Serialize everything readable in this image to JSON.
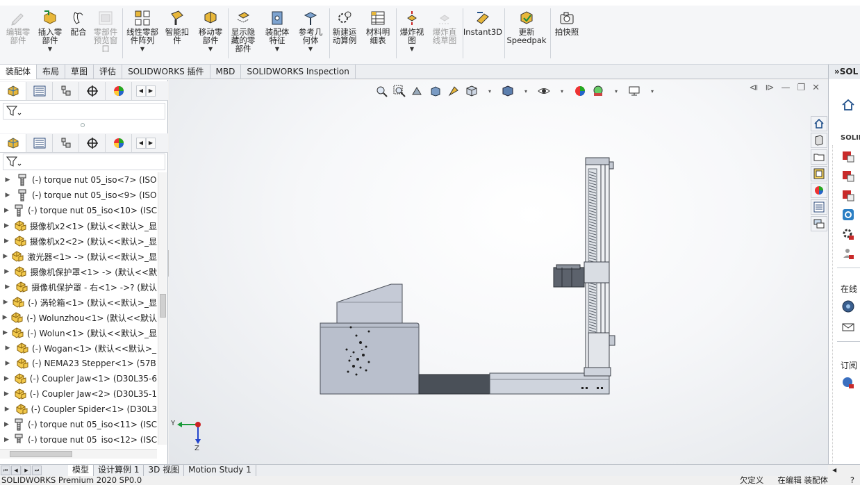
{
  "colors": {
    "accent": "#2b6fb6",
    "part_yellow": "#e8b73a",
    "viewport_bg": "#f4f5f7"
  },
  "ribbon": {
    "buttons": [
      {
        "key": "edit_component",
        "label": "编辑零\n部件",
        "icon": "edit-component-icon",
        "disabled": true,
        "caret": false
      },
      {
        "key": "insert_components",
        "label": "插入零\n部件",
        "icon": "insert-components-icon",
        "disabled": false,
        "caret": true
      },
      {
        "key": "mate",
        "label": "配合",
        "icon": "mate-icon",
        "disabled": false,
        "caret": false
      },
      {
        "key": "component_preview",
        "label": "零部件\n预览窗\n口",
        "icon": "component-preview-icon",
        "disabled": true,
        "caret": false
      },
      {
        "key": "linear_pattern",
        "label": "线性零部\n件阵列",
        "icon": "linear-pattern-icon",
        "disabled": false,
        "caret": true
      },
      {
        "key": "smart_fasteners",
        "label": "智能扣\n件",
        "icon": "smart-fasteners-icon",
        "disabled": false,
        "caret": false
      },
      {
        "key": "move_component",
        "label": "移动零\n部件",
        "icon": "move-component-icon",
        "disabled": false,
        "caret": true
      },
      {
        "key": "show_hidden",
        "label": "显示隐\n藏的零\n部件",
        "icon": "show-hidden-icon",
        "disabled": false,
        "caret": false
      },
      {
        "key": "assembly_features",
        "label": "装配体\n特征",
        "icon": "assembly-features-icon",
        "disabled": false,
        "caret": true
      },
      {
        "key": "reference_geometry",
        "label": "参考几\n何体",
        "icon": "reference-geometry-icon",
        "disabled": false,
        "caret": true
      },
      {
        "key": "new_motion_study",
        "label": "新建运\n动算例",
        "icon": "motion-study-icon",
        "disabled": false,
        "caret": false
      },
      {
        "key": "bom",
        "label": "材料明\n细表",
        "icon": "bom-icon",
        "disabled": false,
        "caret": false
      },
      {
        "key": "exploded_view",
        "label": "爆炸视\n图",
        "icon": "exploded-view-icon",
        "disabled": false,
        "caret": true
      },
      {
        "key": "explode_line",
        "label": "爆炸直\n线草图",
        "icon": "explode-line-icon",
        "disabled": true,
        "caret": false
      },
      {
        "key": "instant3d",
        "label": "Instant3D",
        "icon": "instant3d-icon",
        "disabled": false,
        "caret": false
      },
      {
        "key": "speedpak",
        "label": "更新\nSpeedpak",
        "icon": "speedpak-icon",
        "disabled": false,
        "caret": false
      },
      {
        "key": "snapshot",
        "label": "拍快照",
        "icon": "camera-icon",
        "disabled": false,
        "caret": false
      }
    ]
  },
  "tabs": [
    "装配体",
    "布局",
    "草图",
    "评估",
    "SOLIDWORKS 插件",
    "MBD",
    "SOLIDWORKS Inspection"
  ],
  "active_tab": "装配体",
  "tree": {
    "nodes": [
      {
        "icon": "bolt-icon",
        "label": "(-) torque nut 05_iso<7> (ISO"
      },
      {
        "icon": "bolt-icon",
        "label": "(-) torque nut 05_iso<9> (ISO"
      },
      {
        "icon": "bolt-icon",
        "label": "(-) torque nut 05_iso<10> (ISC"
      },
      {
        "icon": "part-icon",
        "label": "摄像机x2<1> (默认<<默认>_显"
      },
      {
        "icon": "part-icon",
        "label": "摄像机x2<2> (默认<<默认>_显"
      },
      {
        "icon": "part-icon",
        "label": "激光器<1> -> (默认<<默认>_显"
      },
      {
        "icon": "part-icon",
        "label": "摄像机保护罩<1> -> (默认<<默"
      },
      {
        "icon": "part-icon",
        "label": "摄像机保护罩 - 右<1> ->? (默认"
      },
      {
        "icon": "part-icon",
        "label": "(-) 涡轮箱<1> (默认<<默认>_显"
      },
      {
        "icon": "part-icon",
        "label": "(-) Wolunzhou<1> (默认<<默认"
      },
      {
        "icon": "part-icon",
        "label": "(-) Wolun<1> (默认<<默认>_显"
      },
      {
        "icon": "part-icon",
        "label": "(-) Wogan<1> (默认<<默认>_"
      },
      {
        "icon": "part-icon",
        "label": "(-) NEMA23 Stepper<1> (57B"
      },
      {
        "icon": "part-icon",
        "label": "(-) Coupler Jaw<1> (D30L35-6"
      },
      {
        "icon": "part-icon",
        "label": "(-) Coupler Jaw<2> (D30L35-1"
      },
      {
        "icon": "part-icon",
        "label": "(-) Coupler Spider<1> (D30L3"
      },
      {
        "icon": "bolt-icon",
        "label": "(-) torque nut 05_iso<11> (ISC"
      },
      {
        "icon": "bolt-icon",
        "label": "(-) torque nut 05_iso<12> (ISC"
      }
    ]
  },
  "triad": {
    "y": "Y",
    "z": "Z"
  },
  "taskpane": {
    "header": "»SOL",
    "sections": [
      "SOLID",
      "在线",
      "订阅"
    ]
  },
  "bottom_tabs": [
    "模型",
    "设计算例 1",
    "3D 视图",
    "Motion Study 1"
  ],
  "active_bottom_tab": "模型",
  "status": {
    "left": "SOLIDWORKS Premium 2020 SP0.0",
    "underdefined": "欠定义",
    "editing": "在编辑 装配体"
  }
}
